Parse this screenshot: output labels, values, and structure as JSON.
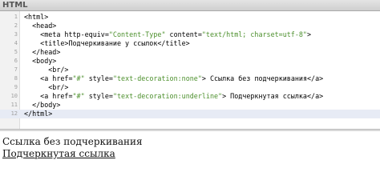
{
  "panel": {
    "title": "HTML"
  },
  "code": {
    "lines": [
      {
        "num": "1",
        "parts": [
          "<html>"
        ]
      },
      {
        "num": "2",
        "parts": [
          "  <head>"
        ]
      },
      {
        "num": "3",
        "parts": [
          "    <meta http-equiv=",
          "\"Content-Type\"",
          " content=",
          "\"text/html; charset=utf-8\"",
          ">"
        ]
      },
      {
        "num": "4",
        "parts": [
          "    <title>Подчеркивание у ссылок</title>"
        ]
      },
      {
        "num": "5",
        "parts": [
          "  </head>"
        ]
      },
      {
        "num": "6",
        "parts": [
          "  <body>"
        ]
      },
      {
        "num": "7",
        "parts": [
          "      <br/>"
        ]
      },
      {
        "num": "8",
        "parts": [
          "    <a href=",
          "\"#\"",
          " style=",
          "\"text-decoration:none\"",
          "> Ссылка без подчеркивания</a>"
        ]
      },
      {
        "num": "9",
        "parts": [
          "      <br/>"
        ]
      },
      {
        "num": "10",
        "parts": [
          "    <a href=",
          "\"#\"",
          " style=",
          "\"text-decoration:underline\"",
          "> Подчеркнутая ссылка</a>"
        ]
      },
      {
        "num": "11",
        "parts": [
          "  </body>"
        ]
      },
      {
        "num": "12",
        "parts": [
          "</html>"
        ]
      }
    ]
  },
  "preview": {
    "plain_link": "Ссылка без подчеркивания",
    "underlined_link": "Подчеркнутая ссылка"
  },
  "colors": {
    "attribute_value": "#4b8f2b",
    "active_line": "#e7ebf5"
  }
}
